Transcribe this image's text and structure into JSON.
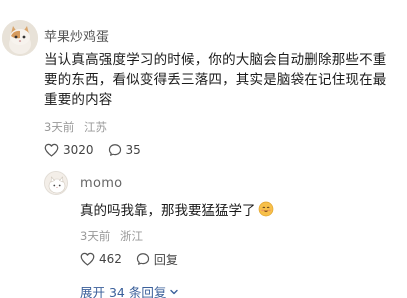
{
  "main_comment": {
    "author": "苹果炒鸡蛋",
    "text": "当认真高强度学习的时候，你的大脑会自动删除那些不重要的东西，看似变得丢三落四，其实是脑袋在记住现在最重要的内容",
    "time": "3天前",
    "location": "江苏",
    "likes": "3020",
    "replies": "35"
  },
  "reply": {
    "author": "momo",
    "text": "真的吗我靠，那我要猛猛学了",
    "emoji": "smiling-face-icon",
    "time": "3天前",
    "location": "浙江",
    "likes": "462",
    "reply_label": "回复"
  },
  "expand_label": "展开 34 条回复",
  "colors": {
    "link": "#3a5f9a",
    "meta": "#999999",
    "text": "#1a1a1a"
  }
}
